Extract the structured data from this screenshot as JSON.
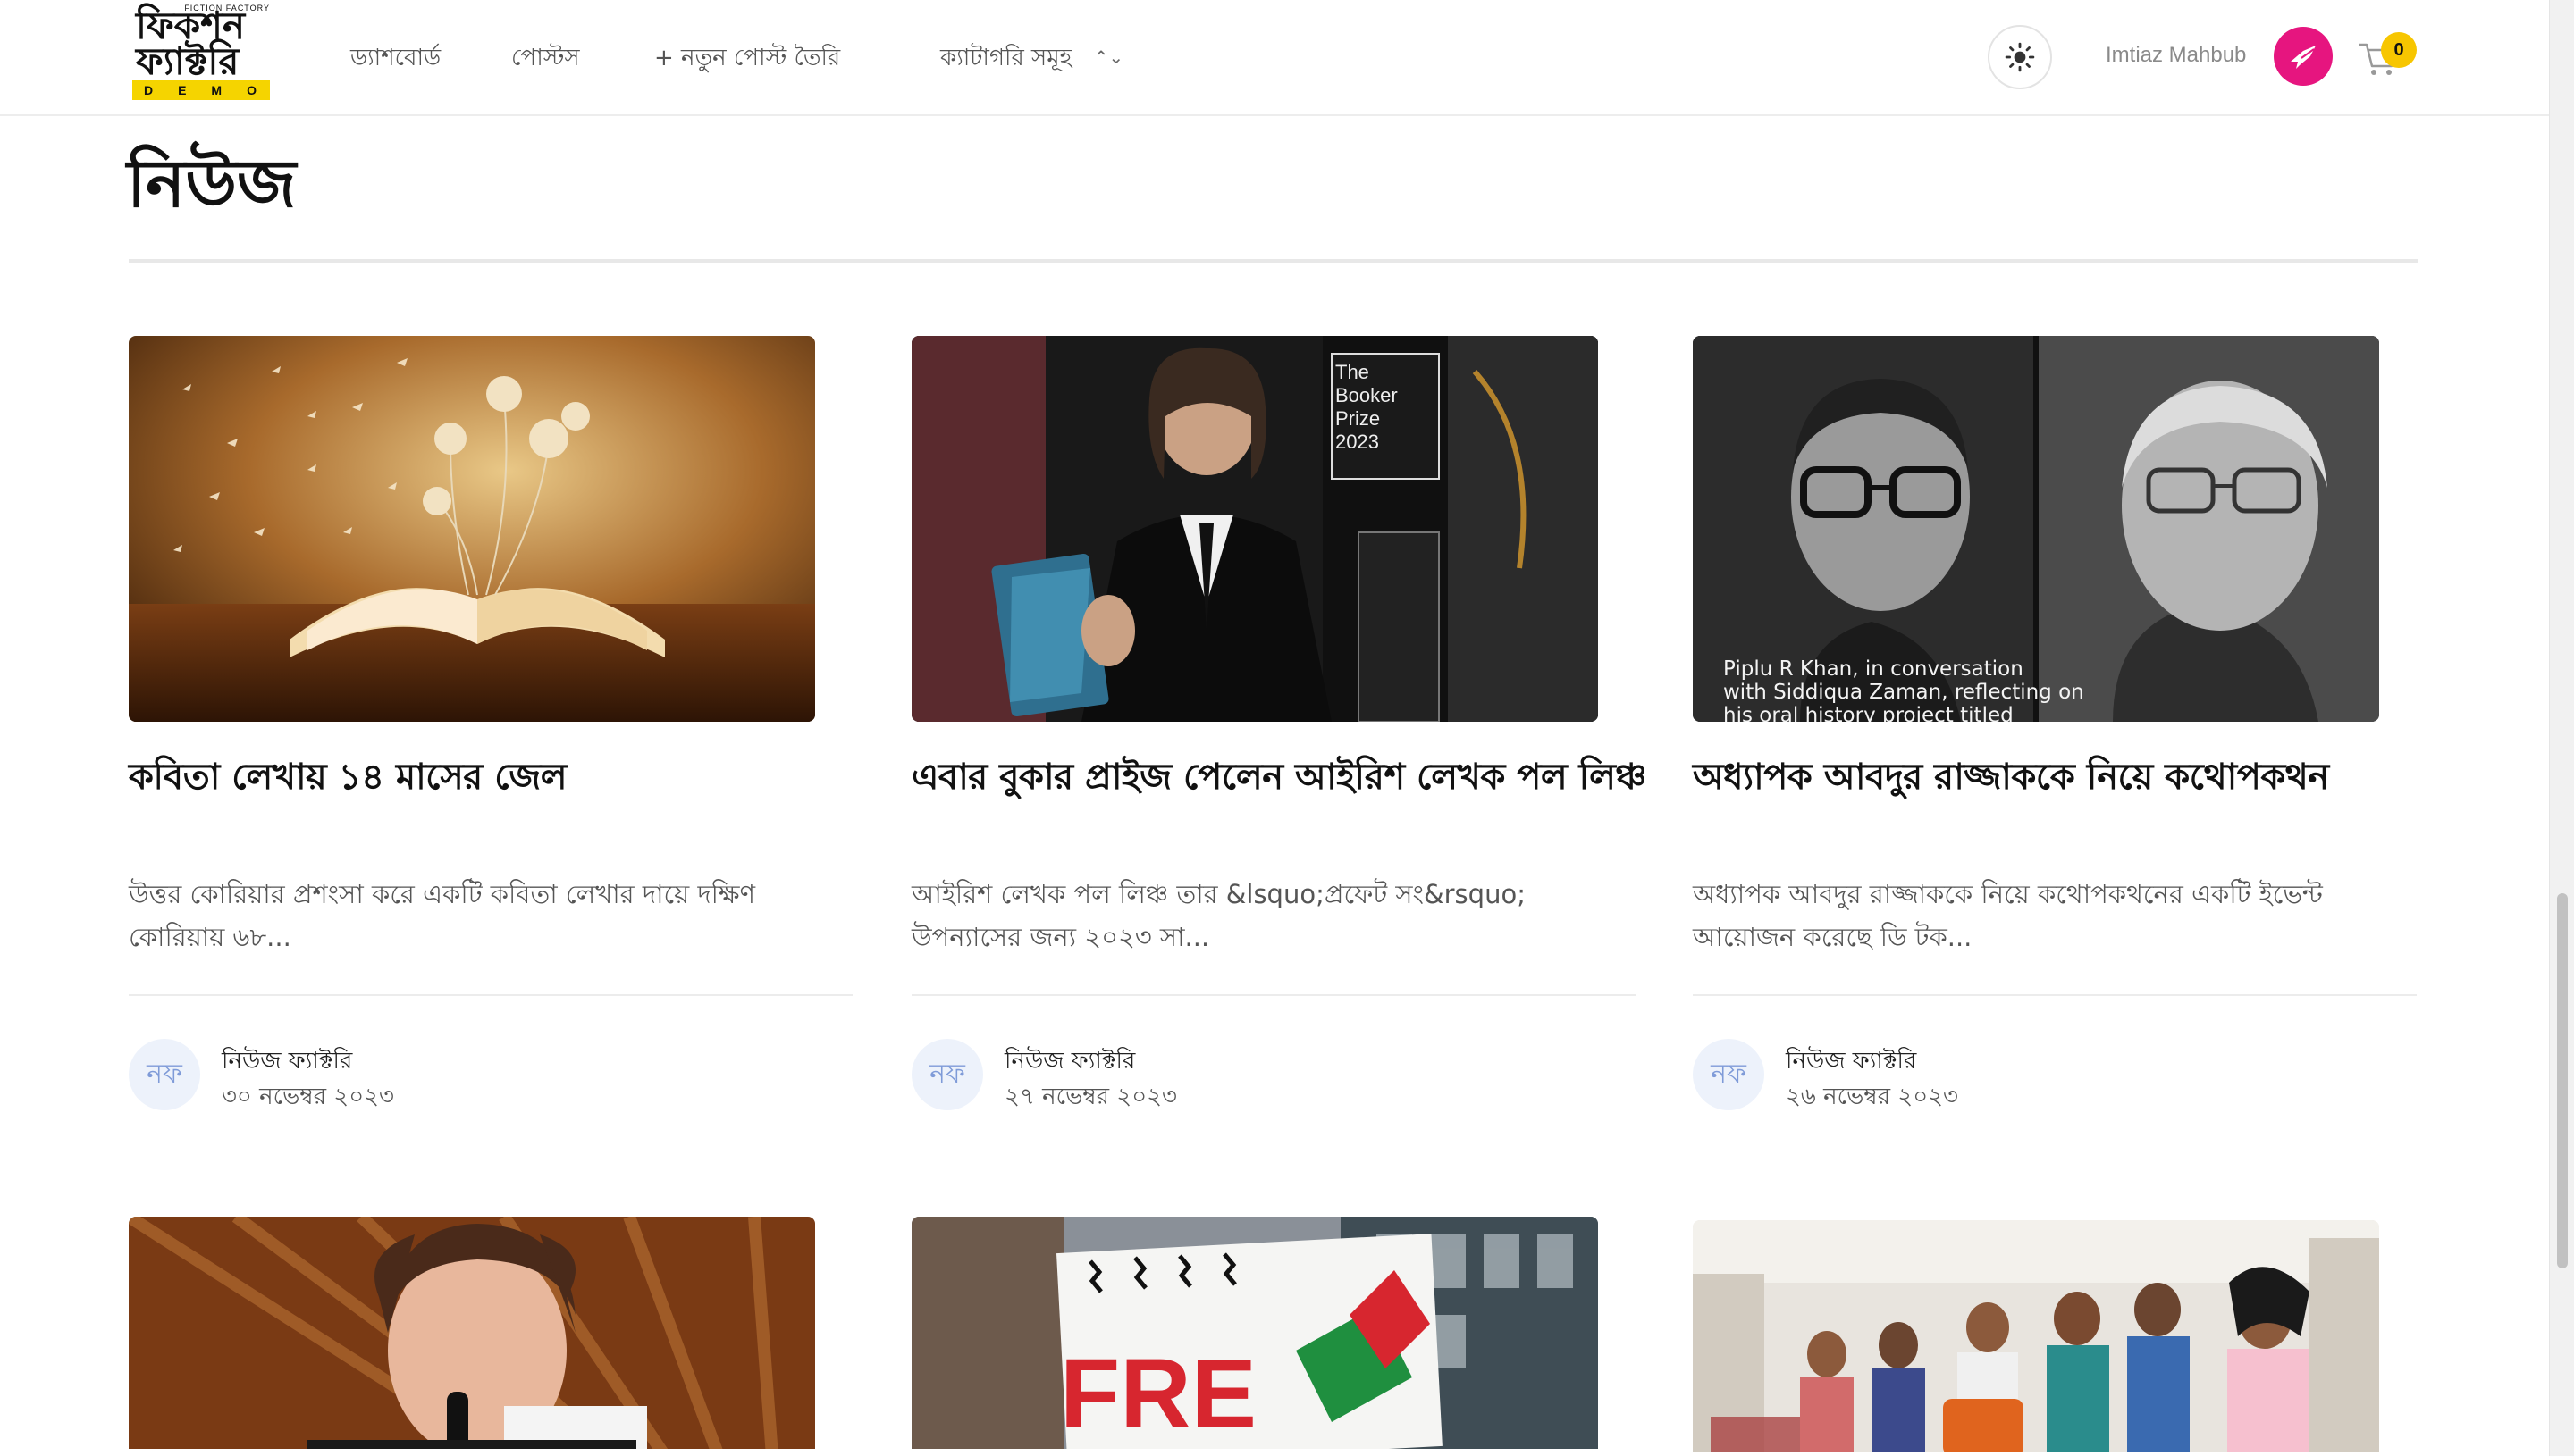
{
  "nav": {
    "logo_tiny": "FICTION FACTORY",
    "logo_line1": "ফিকশন",
    "logo_line2": "ফ্যাক্টরি",
    "logo_demo": [
      "D",
      "E",
      "M",
      "O"
    ],
    "dashboard": "ড্যাশবোর্ড",
    "posts": "পোস্টস",
    "new_post": "+ নতুন পোস্ট তৈরি",
    "categories": "ক্যাটাগরি সমূহ",
    "user_name": "Imtiaz Mahbub",
    "cart_count": "0"
  },
  "page": {
    "title": "নিউজ"
  },
  "cards": [
    {
      "title": "কবিতা লেখায় ১৪ মাসের জেল",
      "excerpt": "উত্তর কোরিয়ার প্রশংসা করে একটি কবিতা লেখার দায়ে দক্ষিণ কোরিয়ায় ৬৮...",
      "initials": "নফ",
      "author": "নিউজ ফ্যাক্টরি",
      "date": "৩০ নভেম্বর ২০২৩"
    },
    {
      "title": "এবার বুকার প্রাইজ পেলেন আইরিশ লেখক পল লিঞ্চ",
      "excerpt": "আইরিশ লেখক পল লিঞ্চ তার &lsquo;প্রফেট সং&rsquo; উপন্যাসের জন্য ২০২৩ সা...",
      "initials": "নফ",
      "author": "নিউজ ফ্যাক্টরি",
      "date": "২৭ নভেম্বর ২০২৩",
      "image_text": [
        "The",
        "Booker",
        "Prize",
        "2023"
      ]
    },
    {
      "title": "অধ্যাপক আবদুর রাজ্জাককে নিয়ে কথোপকথন",
      "excerpt": "অধ্যাপক আবদুর রাজ্জাককে নিয়ে কথোপকথনের একটি ইভেন্ট আয়োজন করেছে ডি টক...",
      "initials": "নফ",
      "author": "নিউজ ফ্যাক্টরি",
      "date": "২৬ নভেম্বর ২০২৩",
      "image_caption": [
        "Piplu R Khan, in conversation",
        "with Siddiqua Zaman, reflecting on",
        "his oral history project titled"
      ]
    }
  ],
  "row2_image_text": "FRE",
  "colors": {
    "accent_avatar": "#e6157f",
    "badge": "#f7c600",
    "logo_bar": "#f5d400"
  }
}
